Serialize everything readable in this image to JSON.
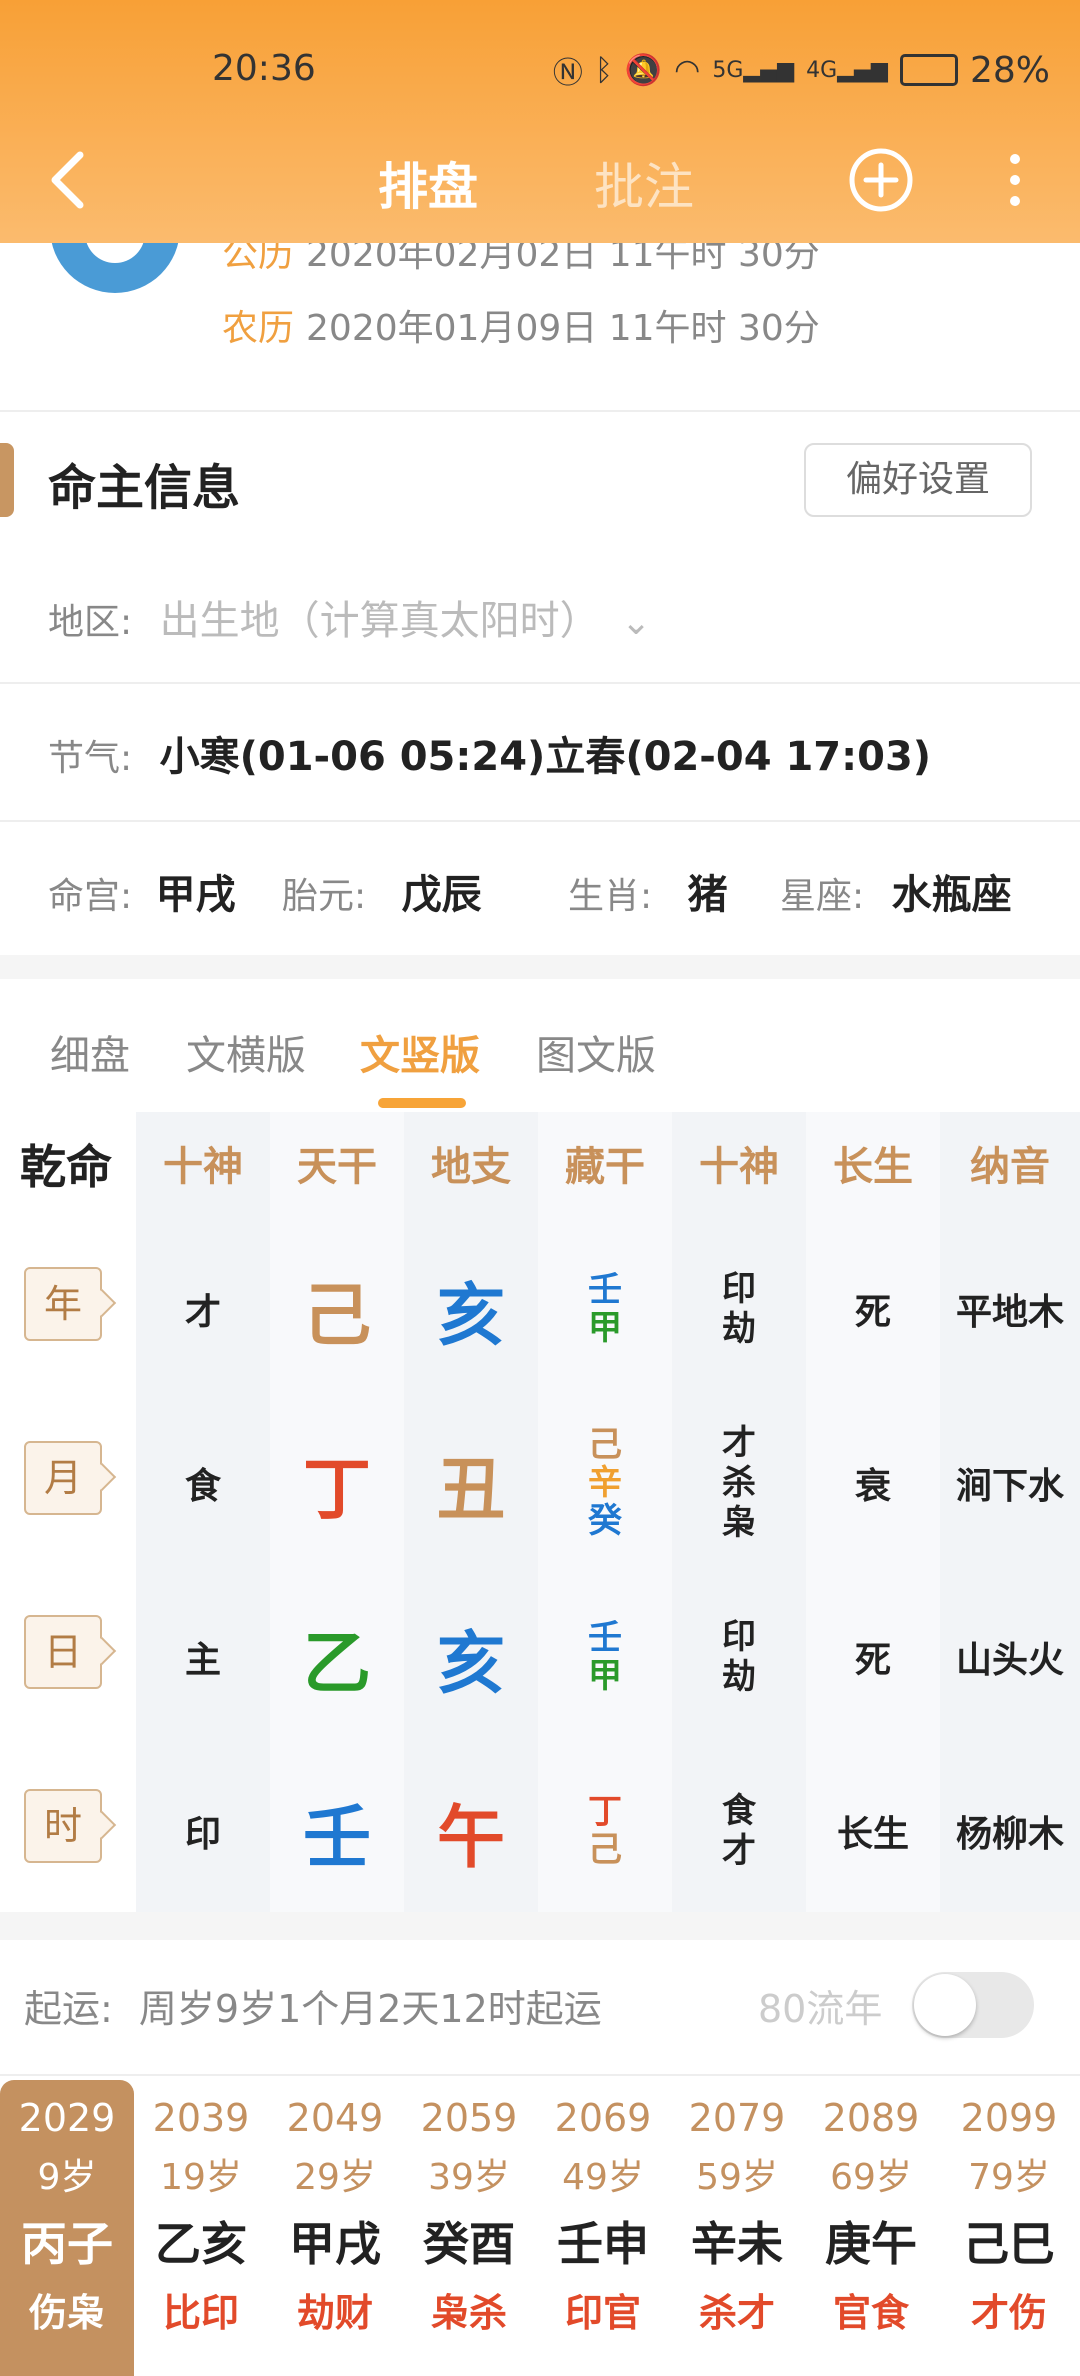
{
  "status": {
    "time": "20:36",
    "battery": "28%",
    "net1": "5G",
    "net2": "4G"
  },
  "nav": {
    "tab_main": "排盘",
    "tab_sub": "批注"
  },
  "birth": {
    "solar_key": "公历",
    "solar_val": "2020年02月02日 11午时 30分",
    "lunar_key": "农历",
    "lunar_val": "2020年01月09日 11午时 30分"
  },
  "info": {
    "title": "命主信息",
    "pref_button": "偏好设置",
    "region_label": "地区:",
    "region_placeholder": "出生地（计算真太阳时）",
    "jieqi_label": "节气:",
    "jieqi_value": "小寒(01-06 05:24)立春(02-04 17:03)",
    "minggong_label": "命宫:",
    "minggong_value": "甲戌",
    "taiyuan_label": "胎元:",
    "taiyuan_value": "戊辰",
    "shengxiao_label": "生肖:",
    "shengxiao_value": "猪",
    "xingzuo_label": "星座:",
    "xingzuo_value": "水瓶座"
  },
  "view_tabs": [
    "细盘",
    "文横版",
    "文竖版",
    "图文版"
  ],
  "chart": {
    "headers": [
      "乾命",
      "十神",
      "天干",
      "地支",
      "藏干",
      "十神",
      "长生",
      "纳音"
    ],
    "rows": [
      {
        "pillar": "年",
        "shishen": "才",
        "tiangan": "己",
        "dizhi": "亥",
        "canggan": [
          "壬",
          "甲"
        ],
        "shishen2": [
          "印",
          "劫"
        ],
        "changsheng": "死",
        "nayin": "平地木"
      },
      {
        "pillar": "月",
        "shishen": "食",
        "tiangan": "丁",
        "dizhi": "丑",
        "canggan": [
          "己",
          "辛",
          "癸"
        ],
        "shishen2": [
          "才",
          "杀",
          "枭"
        ],
        "changsheng": "衰",
        "nayin": "涧下水"
      },
      {
        "pillar": "日",
        "shishen": "主",
        "tiangan": "乙",
        "dizhi": "亥",
        "canggan": [
          "壬",
          "甲"
        ],
        "shishen2": [
          "印",
          "劫"
        ],
        "changsheng": "死",
        "nayin": "山头火"
      },
      {
        "pillar": "时",
        "shishen": "印",
        "tiangan": "壬",
        "dizhi": "午",
        "canggan": [
          "丁",
          "己"
        ],
        "shishen2": [
          "食",
          "才"
        ],
        "changsheng": "长生",
        "nayin": "杨柳木"
      }
    ]
  },
  "qiyun": {
    "label": "起运:",
    "value": "周岁9岁1个月2天12时起运",
    "liunian_label": "80流年"
  },
  "dayun": [
    {
      "year": "2029",
      "age": "9岁",
      "ganzhi": "丙子",
      "shishen": "伤枭"
    },
    {
      "year": "2039",
      "age": "19岁",
      "ganzhi": "乙亥",
      "shishen": "比印"
    },
    {
      "year": "2049",
      "age": "29岁",
      "ganzhi": "甲戌",
      "shishen": "劫财"
    },
    {
      "year": "2059",
      "age": "39岁",
      "ganzhi": "癸酉",
      "shishen": "枭杀"
    },
    {
      "year": "2069",
      "age": "49岁",
      "ganzhi": "壬申",
      "shishen": "印官"
    },
    {
      "year": "2079",
      "age": "59岁",
      "ganzhi": "辛未",
      "shishen": "杀才"
    },
    {
      "year": "2089",
      "age": "69岁",
      "ganzhi": "庚午",
      "shishen": "官食"
    },
    {
      "year": "2099",
      "age": "79岁",
      "ganzhi": "己巳",
      "shishen": "才伤"
    }
  ],
  "colors": {
    "accent": "#f7a438",
    "gold": "#c8915a",
    "red": "#e24a2a",
    "blue": "#1f78d1",
    "green": "#2a9a2a"
  }
}
